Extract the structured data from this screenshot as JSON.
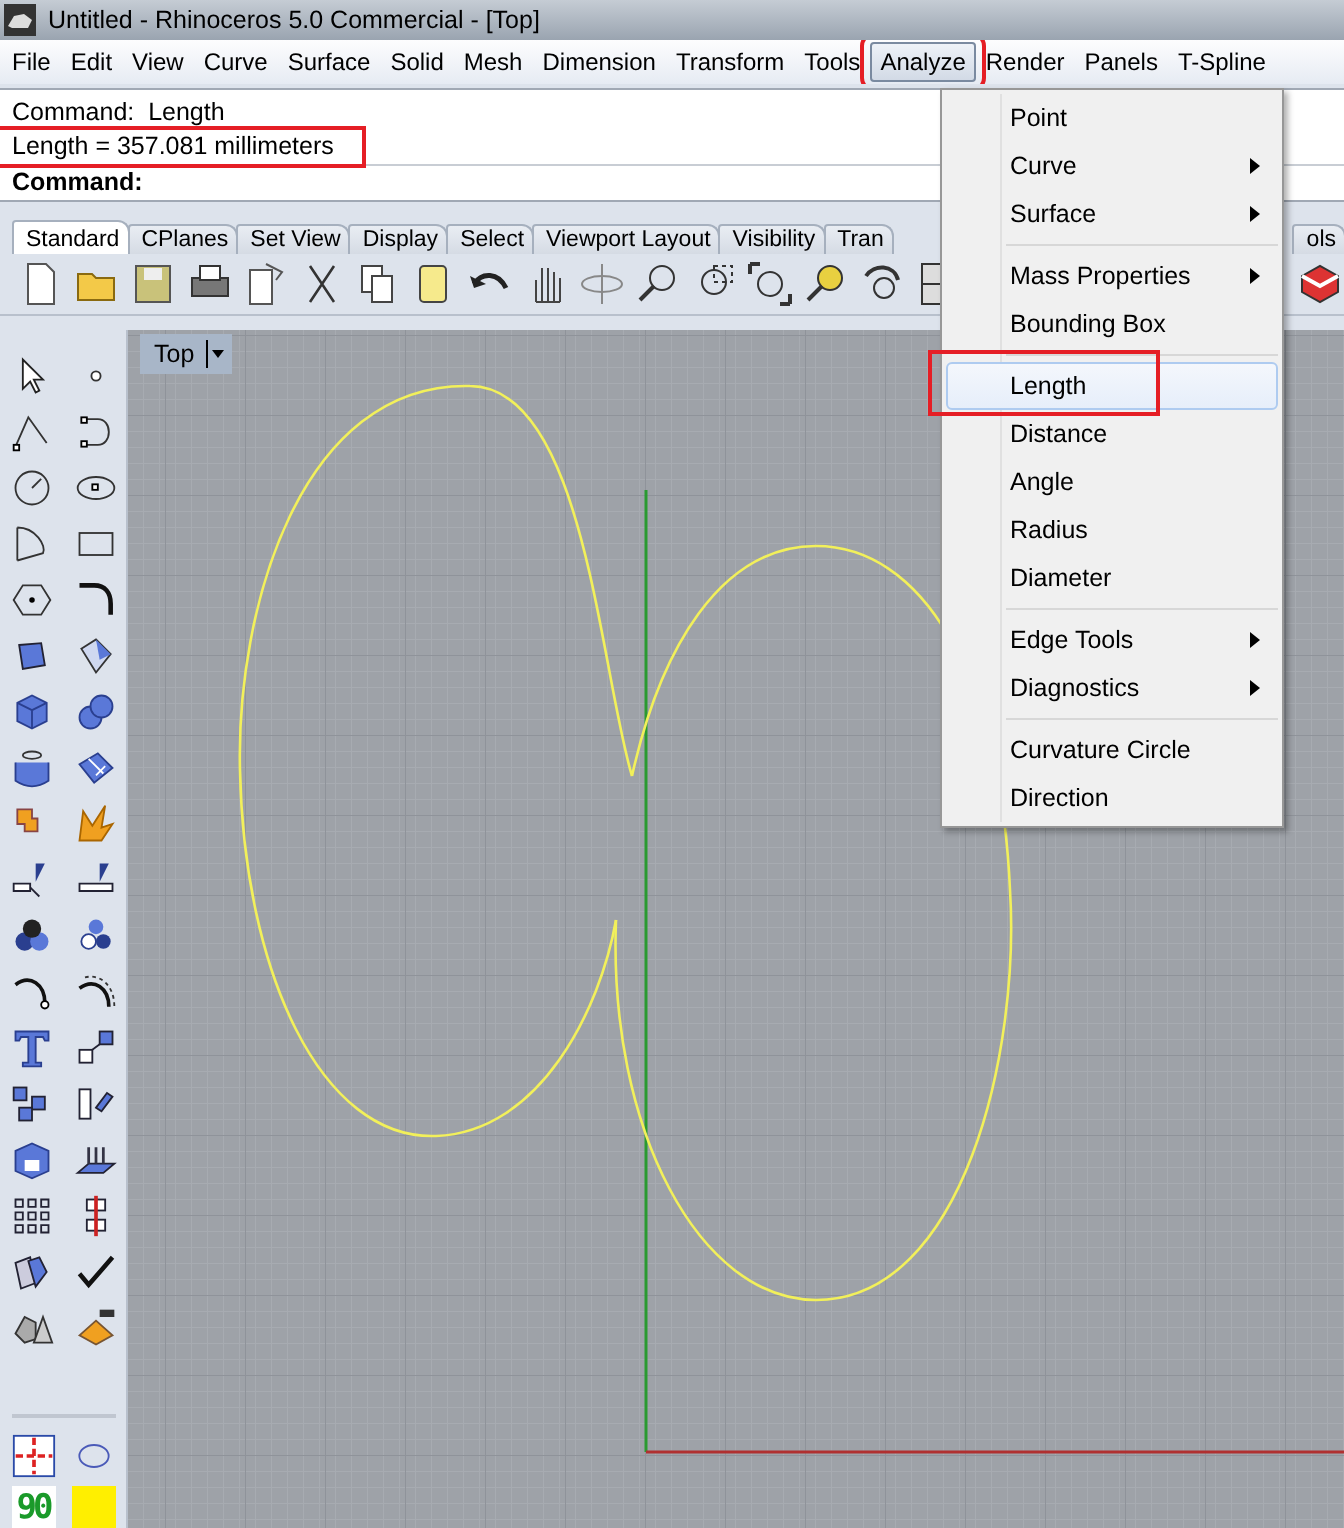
{
  "window": {
    "title": "Untitled - Rhinoceros 5.0 Commercial - [Top]"
  },
  "menu_bar": [
    {
      "label": "File",
      "selected": false,
      "annotated": false
    },
    {
      "label": "Edit",
      "selected": false,
      "annotated": false
    },
    {
      "label": "View",
      "selected": false,
      "annotated": false
    },
    {
      "label": "Curve",
      "selected": false,
      "annotated": false
    },
    {
      "label": "Surface",
      "selected": false,
      "annotated": false
    },
    {
      "label": "Solid",
      "selected": false,
      "annotated": false
    },
    {
      "label": "Mesh",
      "selected": false,
      "annotated": false
    },
    {
      "label": "Dimension",
      "selected": false,
      "annotated": false
    },
    {
      "label": "Transform",
      "selected": false,
      "annotated": false
    },
    {
      "label": "Tools",
      "selected": false,
      "annotated": false
    },
    {
      "label": "Analyze",
      "selected": true,
      "annotated": true
    },
    {
      "label": "Render",
      "selected": false,
      "annotated": false
    },
    {
      "label": "Panels",
      "selected": false,
      "annotated": false
    },
    {
      "label": "T-Spline",
      "selected": false,
      "annotated": false
    }
  ],
  "command_area": {
    "history": [
      {
        "text": "Command:  Length",
        "annotated": false
      },
      {
        "text": "Length = 357.081 millimeters",
        "annotated": true
      }
    ],
    "prompt": "Command:"
  },
  "toolbar_tabs": [
    {
      "label": "Standard",
      "selected": true
    },
    {
      "label": "CPlanes",
      "selected": false
    },
    {
      "label": "Set View",
      "selected": false
    },
    {
      "label": "Display",
      "selected": false
    },
    {
      "label": "Select",
      "selected": false
    },
    {
      "label": "Viewport Layout",
      "selected": false
    },
    {
      "label": "Visibility",
      "selected": false
    },
    {
      "label": "Tran",
      "selected": false
    },
    {
      "label": "ols",
      "selected": false
    }
  ],
  "left_toolbar": {
    "ortho_label": "90"
  },
  "viewport": {
    "title": "Top"
  },
  "analyze_menu": {
    "sections": [
      {
        "items": [
          {
            "label": "Point",
            "has_submenu": false,
            "selected": false,
            "annotated": false
          },
          {
            "label": "Curve",
            "has_submenu": true,
            "selected": false,
            "annotated": false
          },
          {
            "label": "Surface",
            "has_submenu": true,
            "selected": false,
            "annotated": false
          }
        ]
      },
      {
        "items": [
          {
            "label": "Mass Properties",
            "has_submenu": true,
            "selected": false,
            "annotated": false
          },
          {
            "label": "Bounding Box",
            "has_submenu": false,
            "selected": false,
            "annotated": false
          }
        ]
      },
      {
        "items": [
          {
            "label": "Length",
            "has_submenu": false,
            "selected": true,
            "annotated": true
          },
          {
            "label": "Distance",
            "has_submenu": false,
            "selected": false,
            "annotated": false
          },
          {
            "label": "Angle",
            "has_submenu": false,
            "selected": false,
            "annotated": false
          },
          {
            "label": "Radius",
            "has_submenu": false,
            "selected": false,
            "annotated": false
          },
          {
            "label": "Diameter",
            "has_submenu": false,
            "selected": false,
            "annotated": false
          }
        ]
      },
      {
        "items": [
          {
            "label": "Edge Tools",
            "has_submenu": true,
            "selected": false,
            "annotated": false
          },
          {
            "label": "Diagnostics",
            "has_submenu": true,
            "selected": false,
            "annotated": false
          }
        ]
      },
      {
        "items": [
          {
            "label": "Curvature Circle",
            "has_submenu": false,
            "selected": false,
            "annotated": false
          },
          {
            "label": "Direction",
            "has_submenu": false,
            "selected": false,
            "annotated": false
          }
        ]
      }
    ]
  }
}
